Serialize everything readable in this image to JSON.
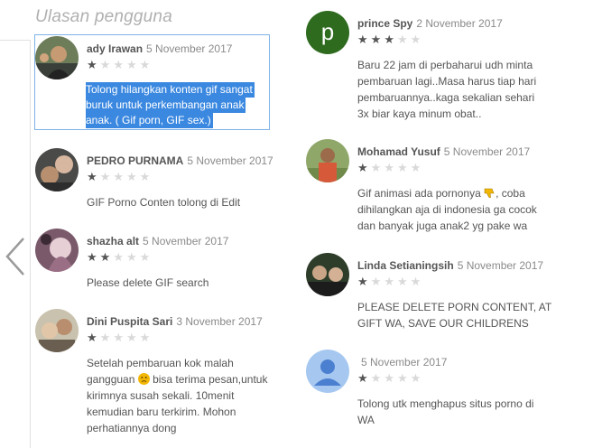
{
  "section_title": "Ulasan pengguna",
  "left_column": [
    {
      "author": "ady Irawan",
      "date": "5 November 2017",
      "rating": 1,
      "selected": true,
      "body": [
        "Tolong hilangkan konten gif sangat",
        "buruk untuk perkembangan anak",
        "anak. ( Gif porn, GIF sex.)"
      ]
    },
    {
      "author": "PEDRO PURNAMA",
      "date": "5 November 2017",
      "rating": 1,
      "body": [
        "GIF Porno Conten tolong di Edit"
      ]
    },
    {
      "author": "shazha alt",
      "date": "5 November 2017",
      "rating": 2,
      "body": [
        "Please delete GIF search"
      ]
    },
    {
      "author": "Dini Puspita Sari",
      "date": "3 November 2017",
      "rating": 1,
      "body_line1_before": "Setelah pembaruan kok malah",
      "body_line2_before": "gangguan",
      "body_line2_after": "bisa terima pesan,untuk",
      "body_rest": [
        "kirimnya susah sekali. 10menit",
        "kemudian baru terkirim. Mohon",
        "perhatiannya dong"
      ],
      "emoji_icon": "sad-face-icon"
    }
  ],
  "right_column": [
    {
      "author": "prince Spy",
      "date": "2 November 2017",
      "rating": 3,
      "avatar_letter": "p",
      "avatar_color": "#2e6b1f",
      "body": [
        "Baru 22 jam di perbaharui udh minta",
        "pembaruan lagi..Masa harus tiap hari",
        "pembaruannya..kaga sekalian sehari",
        "3x biar kaya minum obat.."
      ]
    },
    {
      "author": "Mohamad Yusuf",
      "date": "5 November 2017",
      "rating": 1,
      "body_line1_before": "Gif animasi ada pornonya",
      "body_line1_after": ", coba",
      "body_rest": [
        "dihilangkan aja di indonesia ga cocok",
        "dan banyak juga anak2 yg pake wa"
      ],
      "emoji_icon": "thumbs-down-icon"
    },
    {
      "author": "Linda Setianingsih",
      "date": "5 November 2017",
      "rating": 1,
      "body": [
        "PLEASE DELETE PORN CONTENT, AT",
        "GIFT WA, SAVE OUR CHILDRENS"
      ]
    },
    {
      "author": "",
      "date": "5 November 2017",
      "rating": 1,
      "avatar_color": "#a6c8f0",
      "body": [
        "Tolong utk menghapus situs porno di",
        "WA"
      ]
    }
  ],
  "colors": {
    "selection": "#3b88e0",
    "selection_border": "#7fb2e8",
    "star_on": "#555555",
    "star_off": "#d9d9d9"
  }
}
